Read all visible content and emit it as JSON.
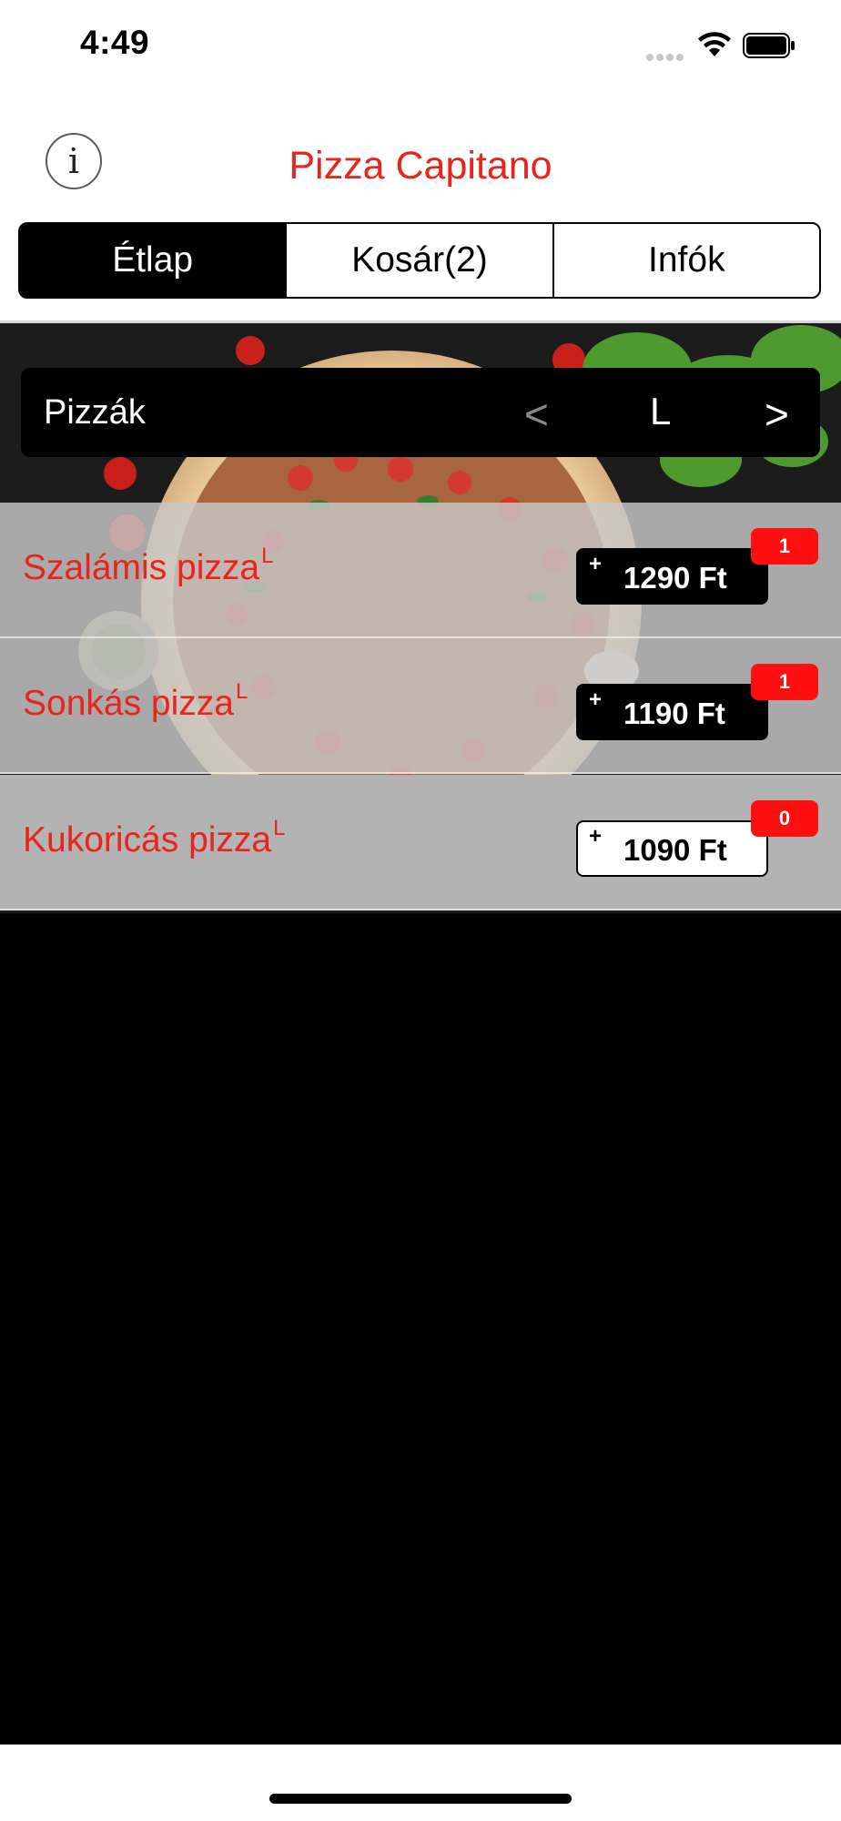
{
  "status_bar": {
    "time": "4:49"
  },
  "header": {
    "title": "Pizza Capitano",
    "info_icon": "info-icon",
    "info_glyph": "i"
  },
  "tabs": [
    {
      "label": "Étlap",
      "active": true
    },
    {
      "label": "Kosár(2)",
      "active": false
    },
    {
      "label": "Infók",
      "active": false
    }
  ],
  "category": {
    "name": "Pizzák",
    "prev": "<",
    "size": "L",
    "next": ">"
  },
  "items": [
    {
      "name": "Szalámis pizza",
      "tag": "L",
      "plus": "+",
      "price": "1290 Ft",
      "count": "1"
    },
    {
      "name": "Sonkás pizza",
      "tag": "L",
      "plus": "+",
      "price": "1190 Ft",
      "count": "1"
    },
    {
      "name": "Kukoricás pizza",
      "tag": "L",
      "plus": "+",
      "price": "1090 Ft",
      "count": "0"
    }
  ],
  "colors": {
    "brand_red": "#e8241c",
    "badge_red": "#ff0f0f",
    "active_tab": "#000000"
  }
}
